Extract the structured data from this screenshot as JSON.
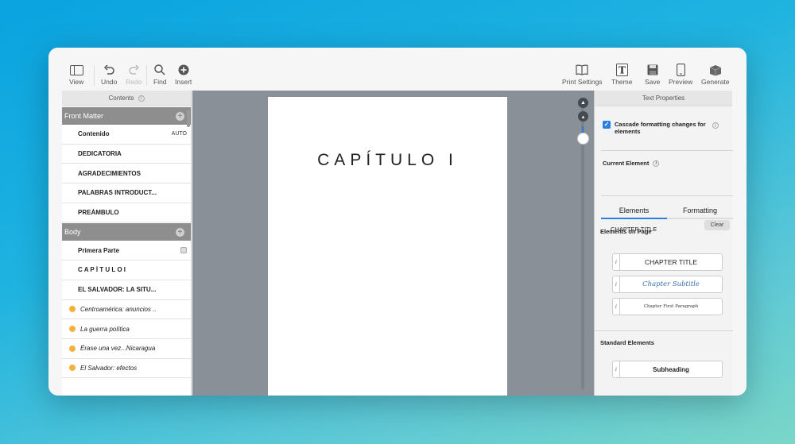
{
  "toolbar": {
    "left": [
      {
        "label": "View",
        "icon": "sidebar-icon"
      },
      {
        "label": "Undo",
        "icon": "undo-icon"
      },
      {
        "label": "Redo",
        "icon": "redo-icon"
      },
      {
        "label": "Find",
        "icon": "magnifier-icon"
      },
      {
        "label": "Insert",
        "icon": "plus-circle-icon"
      }
    ],
    "right": [
      {
        "label": "Print Settings",
        "icon": "book-icon"
      },
      {
        "label": "Theme",
        "icon": "theme-icon"
      },
      {
        "label": "Save",
        "icon": "save-icon"
      },
      {
        "label": "Preview",
        "icon": "phone-icon"
      },
      {
        "label": "Generate",
        "icon": "box-icon"
      }
    ]
  },
  "sidebar": {
    "title": "Contents",
    "front_matter": {
      "label": "Front Matter",
      "items": [
        {
          "label": "Contenido",
          "tag": "AUTO"
        },
        {
          "label": "DEDICATORIA"
        },
        {
          "label": "AGRADECIMIENTOS"
        },
        {
          "label": "PALABRAS INTRODUCT..."
        },
        {
          "label": "PREÁMBULO"
        }
      ]
    },
    "body": {
      "label": "Body",
      "items": [
        {
          "label": "Primera Parte"
        },
        {
          "label": "C A P Í T U L O  I"
        },
        {
          "label": "EL SALVADOR: LA SITU..."
        }
      ],
      "sub_items": [
        {
          "label": "Centroamérica: anuncios .."
        },
        {
          "label": "La guerra política"
        },
        {
          "label": "Érase una vez...Nicaragua"
        },
        {
          "label": "El Salvador: efectos"
        }
      ]
    }
  },
  "canvas": {
    "chapter_title": "CAPÍTULO I"
  },
  "text_properties": {
    "title": "Text Properties",
    "cascade_label": "Cascade formatting changes for elements",
    "cascade_checked": true,
    "current_element_label": "Current Element",
    "current_element_value": "CHAPTER TITLE",
    "clear_label": "Clear",
    "tabs": [
      "Elements",
      "Formatting"
    ],
    "elements_on_page_label": "Elements on Page",
    "elements_on_page": [
      "CHAPTER TITLE",
      "Chapter Subtitle",
      "Chapter First Paragraph"
    ],
    "standard_elements_label": "Standard Elements",
    "standard_elements": [
      "Subheading"
    ]
  },
  "colors": {
    "accent": "#2a7fe0",
    "section_header": "#8e8e8e",
    "dot": "#f4b23c",
    "subtitle": "#3a6fb0"
  }
}
